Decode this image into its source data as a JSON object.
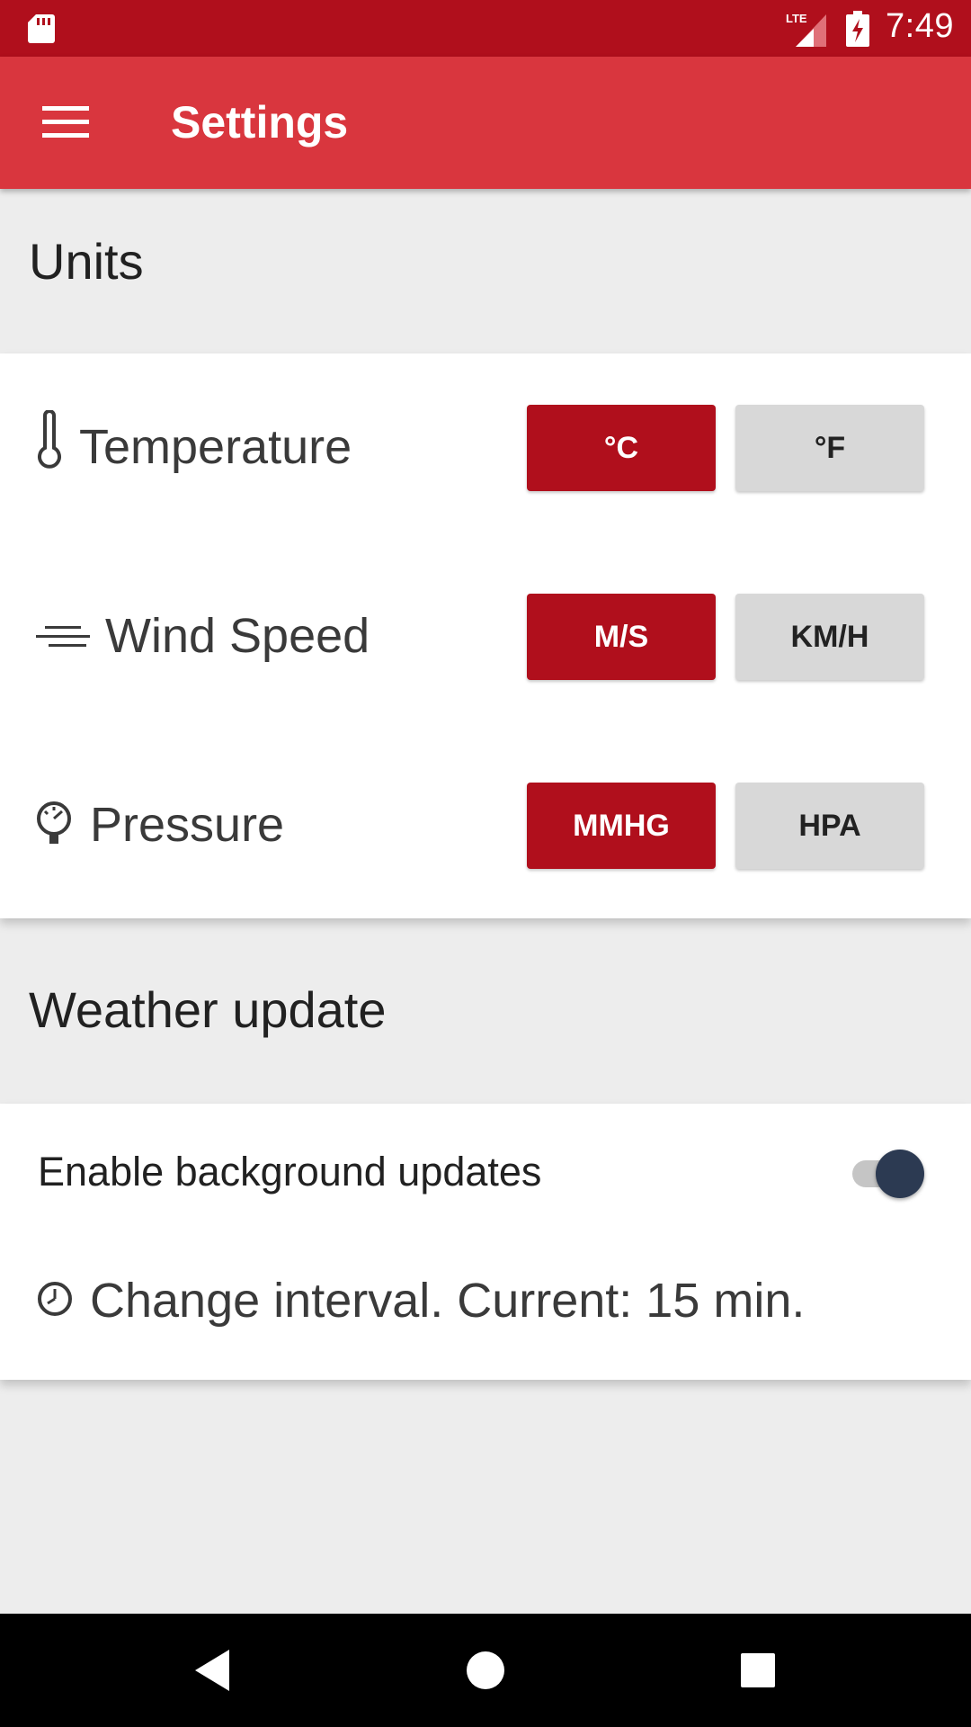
{
  "status_bar": {
    "time": "7:49",
    "network_label": "LTE",
    "icons": [
      "sd-card-icon",
      "lte-signal-icon",
      "battery-charging-icon"
    ]
  },
  "app_bar": {
    "title": "Settings",
    "menu_icon": "hamburger-menu-icon",
    "color": "#d9363e"
  },
  "colors": {
    "status_bar": "#b00f1c",
    "accent": "#b00f1c",
    "inactive_button": "#d8d8d8",
    "toggle_thumb": "#2c3a52"
  },
  "units": {
    "header": "Units",
    "rows": [
      {
        "icon": "thermometer-icon",
        "label": "Temperature",
        "options": [
          "°C",
          "°F"
        ],
        "selected": "°C"
      },
      {
        "icon": "wind-icon",
        "label": "Wind Speed",
        "options": [
          "M/S",
          "KM/H"
        ],
        "selected": "M/S"
      },
      {
        "icon": "pressure-gauge-icon",
        "label": "Pressure",
        "options": [
          "MMHG",
          "HPA"
        ],
        "selected": "MMHG"
      }
    ]
  },
  "weather_update": {
    "header": "Weather update",
    "background_updates": {
      "label": "Enable background updates",
      "enabled": true
    },
    "interval": {
      "icon": "clock-icon",
      "label": "Change interval. Current: 15 min."
    }
  },
  "nav_bar": {
    "buttons": [
      "back-icon",
      "home-icon",
      "recents-icon"
    ]
  }
}
